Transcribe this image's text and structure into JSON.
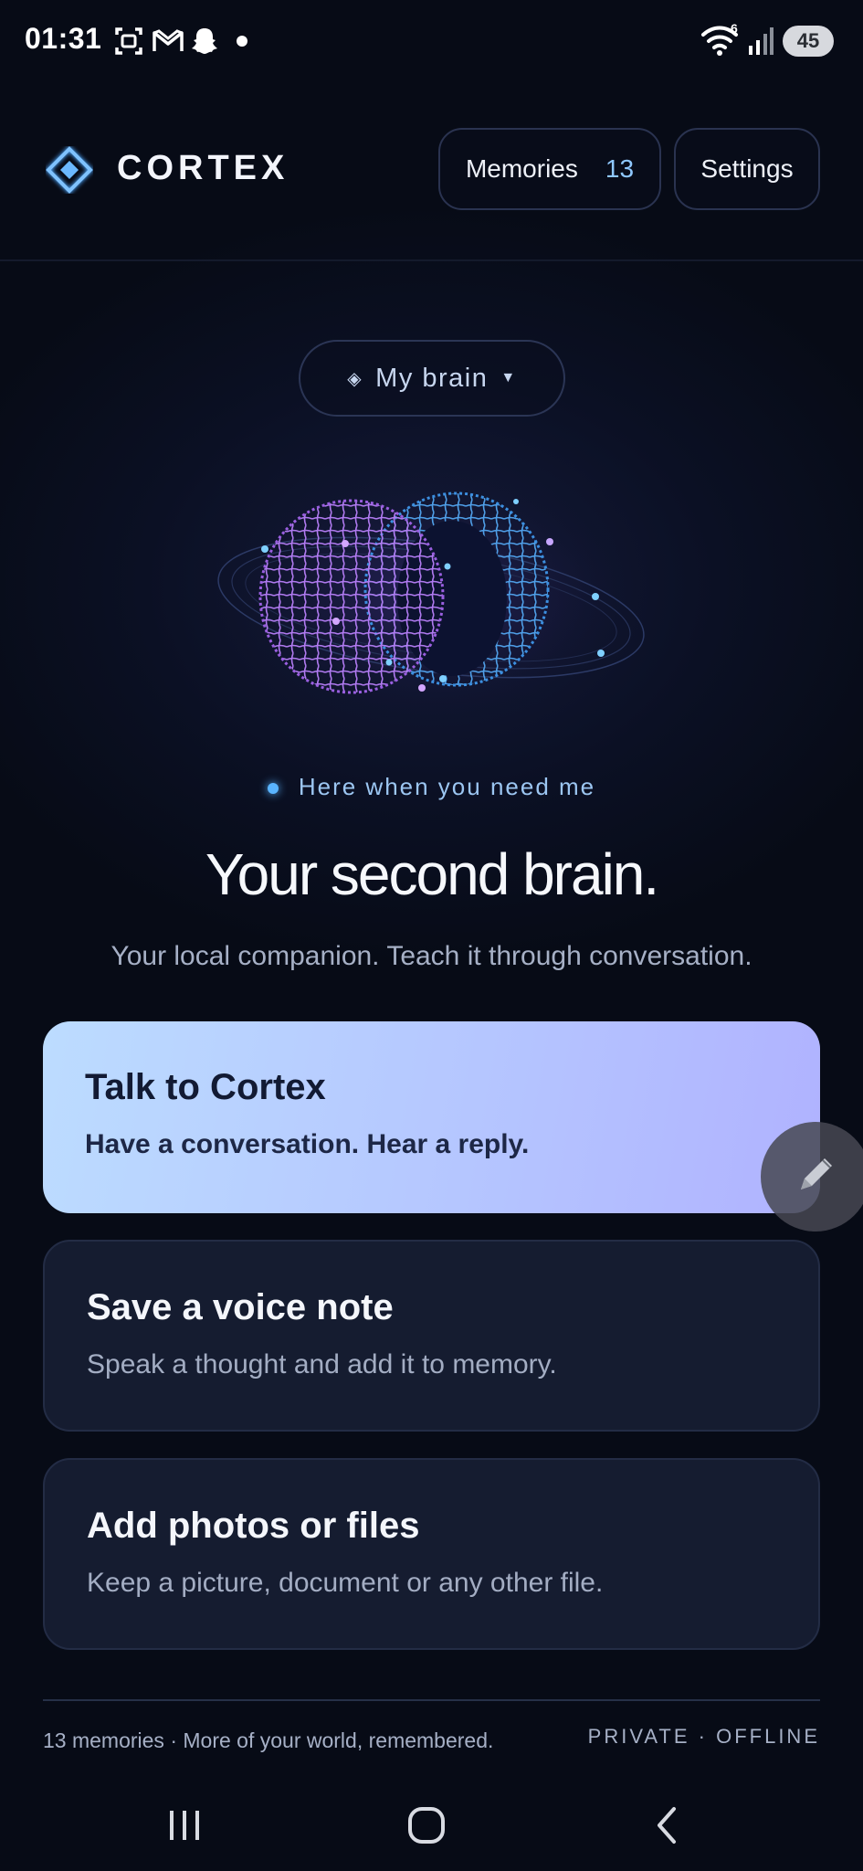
{
  "status_bar": {
    "time": "01:31",
    "icons": [
      "screenshot-icon",
      "gmail-icon",
      "snapchat-icon",
      "notification-dot-icon",
      "wifi-icon",
      "signal-icon"
    ],
    "wifi_badge": "6",
    "battery": "45"
  },
  "header": {
    "brand": "CORTEX",
    "memories_label": "Memories",
    "memories_count": "13",
    "settings_label": "Settings"
  },
  "brain_selector": {
    "label": "My brain"
  },
  "tagline": "Here when you need me",
  "headline": "Your second brain.",
  "subline": "Your local companion. Teach it through conversation.",
  "cards": [
    {
      "title": "Talk to Cortex",
      "description": "Have a conversation. Hear a reply."
    },
    {
      "title": "Save a voice note",
      "description": "Speak a thought and add it to memory."
    },
    {
      "title": "Add photos or files",
      "description": "Keep a picture, document or any other file."
    }
  ],
  "footer": {
    "left": "13 memories · More of your world, remembered.",
    "right": "PRIVATE · OFFLINE"
  },
  "colors": {
    "background": "#070b16",
    "accent": "#5ab4ff",
    "talk_card_gradient_start": "#bcdcff",
    "talk_card_gradient_end": "#b0b2ff",
    "card_surface": "#151c30"
  },
  "nav_bar": {
    "icons": [
      "recents-icon",
      "home-icon",
      "back-icon"
    ]
  }
}
